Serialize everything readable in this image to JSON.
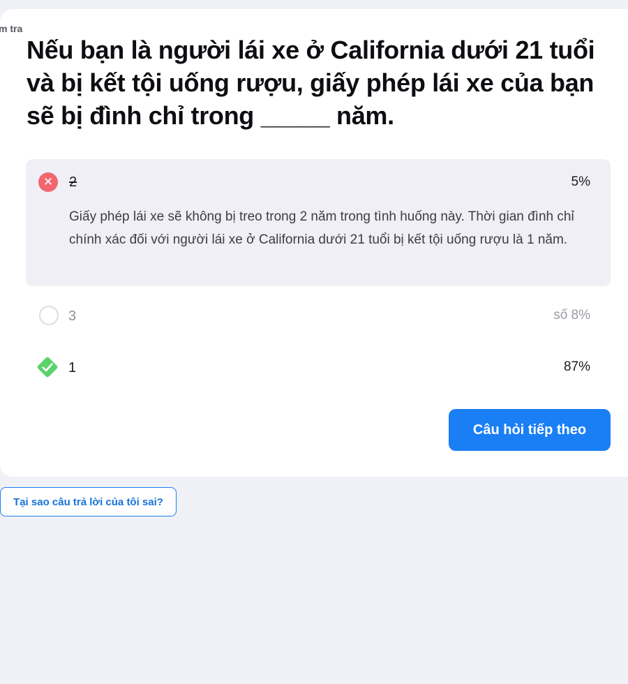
{
  "eyebrow": "m tra",
  "question": "Nếu bạn là người lái xe ở California dưới 21 tuổi và bị kết tội uống rượu, giấy phép lái xe của bạn sẽ bị đình chỉ trong _____ năm.",
  "options": [
    {
      "label": "2",
      "percent": "5%",
      "state": "wrong-selected",
      "icon": "x-icon",
      "explanation": "Giấy phép lái xe sẽ không bị treo trong 2 năm trong tình huống này. Thời gian đình chỉ chính xác đối với người lái xe ở California dưới 21 tuổi bị kết tội uống rượu là 1 năm."
    },
    {
      "label": "3",
      "percent": "số 8%",
      "state": "unselected",
      "icon": "empty-circle-icon"
    },
    {
      "label": "1",
      "percent": "87%",
      "state": "correct",
      "icon": "check-diamond-icon"
    }
  ],
  "next_button": "Câu hỏi tiếp theo",
  "why_button": "Tại sao câu trả lời của tôi sai?",
  "colors": {
    "background": "#f0f1f6",
    "accent": "#1a7ff5",
    "wrong": "#f2666f",
    "correct": "#5ad36a"
  }
}
